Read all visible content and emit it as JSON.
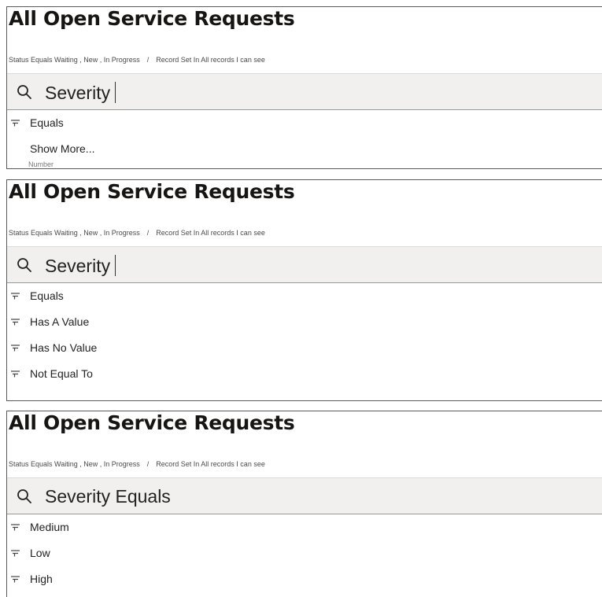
{
  "panels": [
    {
      "title": "All Open Service Requests",
      "breadcrumb": {
        "status_filter": "Status Equals Waiting , New , In Progress",
        "separator": "/",
        "record_set": "Record Set In All records I can see"
      },
      "search": {
        "value": "Severity",
        "icon": "search-icon",
        "caret": true
      },
      "items": [
        {
          "label": "Equals",
          "icon": "filter-icon"
        },
        {
          "label": "Show More...",
          "icon": ""
        }
      ],
      "clipped_text": "Number"
    },
    {
      "title": "All Open Service Requests",
      "breadcrumb": {
        "status_filter": "Status Equals Waiting , New , In Progress",
        "separator": "/",
        "record_set": "Record Set In All records I can see"
      },
      "search": {
        "value": "Severity",
        "icon": "search-icon",
        "caret": true
      },
      "items": [
        {
          "label": "Equals",
          "icon": "filter-icon"
        },
        {
          "label": "Has A Value",
          "icon": "filter-icon"
        },
        {
          "label": "Has No Value",
          "icon": "filter-icon"
        },
        {
          "label": "Not Equal To",
          "icon": "filter-icon"
        }
      ]
    },
    {
      "title": "All Open Service Requests",
      "breadcrumb": {
        "status_filter": "Status Equals Waiting , New , In Progress",
        "separator": "/",
        "record_set": "Record Set In All records I can see"
      },
      "search": {
        "value": "Severity Equals",
        "icon": "search-icon",
        "caret": false
      },
      "items": [
        {
          "label": "Medium",
          "icon": "filter-icon"
        },
        {
          "label": "Low",
          "icon": "filter-icon"
        },
        {
          "label": "High",
          "icon": "filter-icon"
        }
      ]
    }
  ],
  "colors": {
    "search_bar_bg": "#f1f0ee",
    "title_text": "#161513",
    "panel_border": "#5a5a5a"
  }
}
